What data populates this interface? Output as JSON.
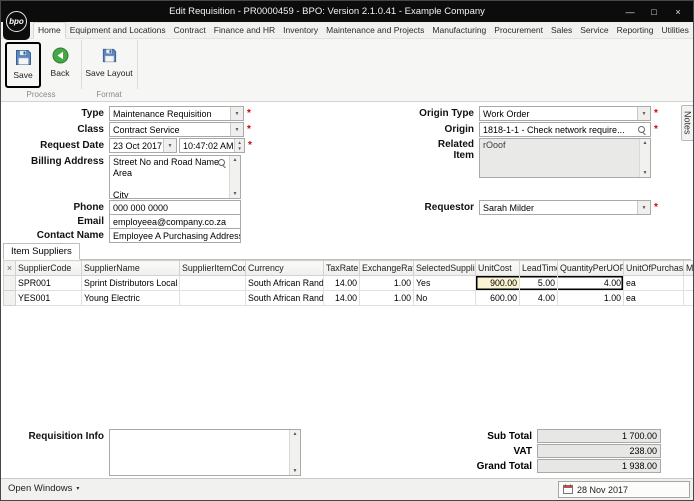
{
  "window": {
    "title": "Edit Requisition - PR0000459 - BPO: Version 2.1.0.41 - Example Company",
    "logo": "bpo",
    "minimize": "—",
    "maximize": "□",
    "close": "×"
  },
  "icons": {
    "dropdown": "▼",
    "up": "▲",
    "down": "▼",
    "caret": "▾"
  },
  "ribbon": {
    "tabs": [
      "Home",
      "Equipment and Locations",
      "Contract",
      "Finance and HR",
      "Inventory",
      "Maintenance and Projects",
      "Manufacturing",
      "Procurement",
      "Sales",
      "Service",
      "Reporting",
      "Utilities"
    ],
    "save": "Save",
    "back": "Back",
    "save_layout": "Save Layout",
    "groups": {
      "process": "Process",
      "format": "Format"
    }
  },
  "form": {
    "required_marker": "*",
    "type_label": "Type",
    "type_value": "Maintenance Requisition",
    "class_label": "Class",
    "class_value": "Contract Service",
    "request_date_label": "Request Date",
    "request_date": "23 Oct 2017",
    "request_time": "10:47:02 AM",
    "billing_address_label": "Billing Address",
    "billing_address": "Street No and Road Name\nArea\n\nCity",
    "phone_label": "Phone",
    "phone": "000 000 0000",
    "email_label": "Email",
    "email": "employeea@company.co.za",
    "contact_name_label": "Contact Name",
    "contact_name": "Employee A Purchasing Address",
    "origin_type_label": "Origin Type",
    "origin_type": "Work Order",
    "origin_label": "Origin",
    "origin": "1818-1-1 - Check network require...",
    "related_item_label": "Related Item",
    "related_item": "rOoof",
    "requestor_label": "Requestor",
    "requestor": "Sarah Milder",
    "notes_tab": "Notes"
  },
  "grid": {
    "tab": "Item Suppliers",
    "columns": [
      "×",
      "SupplierCode",
      "SupplierName",
      "SupplierItemCode",
      "Currency",
      "TaxRate",
      "ExchangeRate",
      "SelectedSupplier",
      "UnitCost",
      "LeadTime",
      "QuantityPerUOP",
      "UnitOfPurchase",
      "M"
    ],
    "rows": [
      [
        "",
        "SPR001",
        "Sprint Distributors Local",
        "",
        "South African Rand",
        "14.00",
        "1.00",
        "Yes",
        "900.00",
        "5.00",
        "4.00",
        "ea",
        ""
      ],
      [
        "",
        "YES001",
        "Young Electric",
        "",
        "South African Rand",
        "14.00",
        "1.00",
        "No",
        "600.00",
        "4.00",
        "1.00",
        "ea",
        ""
      ]
    ]
  },
  "footer": {
    "requisition_info_label": "Requisition Info",
    "sub_total_label": "Sub Total",
    "sub_total": "1 700.00",
    "vat_label": "VAT",
    "vat": "238.00",
    "grand_total_label": "Grand Total",
    "grand_total": "1 938.00"
  },
  "statusbar": {
    "open_windows": "Open Windows",
    "date": "28 Nov 2017"
  }
}
